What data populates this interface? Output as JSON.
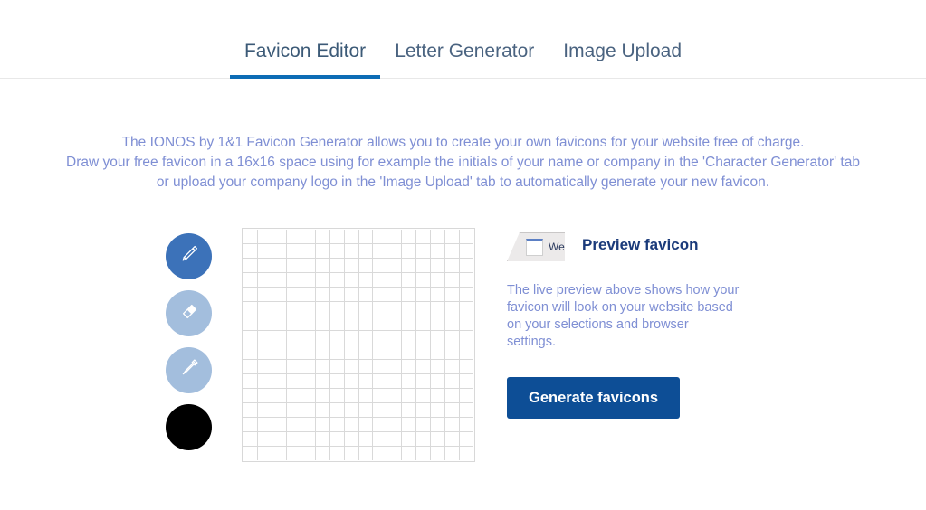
{
  "tabs": [
    {
      "label": "Favicon Editor",
      "active": true
    },
    {
      "label": "Letter Generator",
      "active": false
    },
    {
      "label": "Image Upload",
      "active": false
    }
  ],
  "intro": {
    "line1": "The IONOS by 1&1 Favicon Generator allows you to create your own favicons for your website free of charge.",
    "line2": "Draw your free favicon in a 16x16 space using for example the initials of your name or company in the 'Character Generator' tab",
    "line3": "or upload your company logo in the 'Image Upload' tab to automatically generate your new favicon."
  },
  "tools": [
    {
      "name": "pencil-tool",
      "icon": "pencil-icon",
      "active": true,
      "color": "#3c72b9"
    },
    {
      "name": "eraser-tool",
      "icon": "eraser-icon",
      "active": false,
      "color": "#a3bedd"
    },
    {
      "name": "color-picker-tool",
      "icon": "eyedropper-icon",
      "active": false,
      "color": "#a3bedd"
    },
    {
      "name": "color-swatch",
      "icon": "color-swatch-icon",
      "active": false,
      "color": "#000000"
    }
  ],
  "canvas": {
    "columns": 16,
    "rows": 16,
    "cell_color": "#ffffff",
    "grid_line_color": "#d9d9d9"
  },
  "preview": {
    "tab_mock_label": "Web",
    "title": "Preview favicon",
    "description": "The live preview above shows how your favicon will look on your website based on your selections and browser settings.",
    "generate_label": "Generate favicons"
  },
  "colors": {
    "accent_underline": "#0d6cb5",
    "button_blue": "#0d4e96",
    "body_text": "#7f8fd4",
    "heading_navy": "#1a3a7a",
    "tab_text": "#4a6380"
  }
}
